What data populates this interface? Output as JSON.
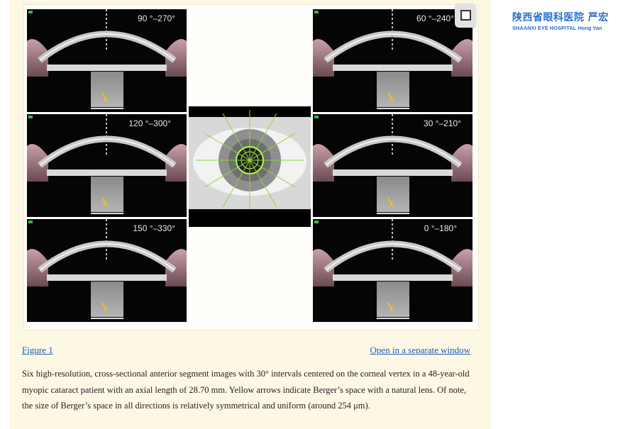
{
  "figure": {
    "tiles": [
      {
        "label": "90 °–270°"
      },
      {
        "label": "60 °–240°"
      },
      {
        "label": "120 °–300°"
      },
      {
        "label": "30 °–210°"
      },
      {
        "label": "150 °–330°"
      },
      {
        "label": "0 °–180°"
      }
    ],
    "link_label": "Figure 1",
    "open_label": "Open in a separate window",
    "caption": "Six high-resolution, cross-sectional anterior segment images with 30° intervals centered on the corneal vertex in a 48-year-old myopic cataract patient with an axial length of 28.70 mm. Yellow arrows indicate Berger’s space with a natural lens. Of note, the size of Berger’s space in all directions is relatively symmetrical and uniform (around 254 μm)."
  },
  "brand": {
    "chinese": "陕西省眼科医院 严宏",
    "english": "SHAANXI EYE HOSPITAL  Hong Yan"
  },
  "colors": {
    "link": "#1a5bb5",
    "brand": "#2a6fd0",
    "arrow": "#f0c020",
    "panel": "#fdf8e4"
  }
}
